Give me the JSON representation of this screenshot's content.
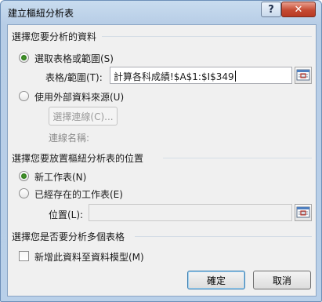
{
  "dialog": {
    "title": "建立樞紐分析表",
    "help_glyph": "?",
    "close_glyph": "✕"
  },
  "source": {
    "section_label": "選擇您要分析的資料",
    "option_range_label": "選取表格或範圍(S)",
    "option_range_selected": true,
    "range_field_label": "表格/範圍(T):",
    "range_field_value": "計算各科成績!$A$1:$I$349",
    "option_external_label": "使用外部資料來源(U)",
    "option_external_selected": false,
    "choose_connection_button": "選擇連線(C)...",
    "connection_name_label": "連線名稱:"
  },
  "placement": {
    "section_label": "選擇您要放置樞紐分析表的位置",
    "option_new_sheet_label": "新工作表(N)",
    "option_new_sheet_selected": true,
    "option_existing_label": "已經存在的工作表(E)",
    "option_existing_selected": false,
    "location_label": "位置(L):",
    "location_value": ""
  },
  "multiple": {
    "section_label": "選擇您是否要分析多個表格",
    "add_to_model_label": "新增此資料至資料模型(M)",
    "add_to_model_checked": false
  },
  "buttons": {
    "ok": "確定",
    "cancel": "取消"
  },
  "colors": {
    "frame": "#b9d0e9",
    "client": "#f0f0f0",
    "radio_checked": "#2e7d1b",
    "close_button": "#c54a32"
  }
}
